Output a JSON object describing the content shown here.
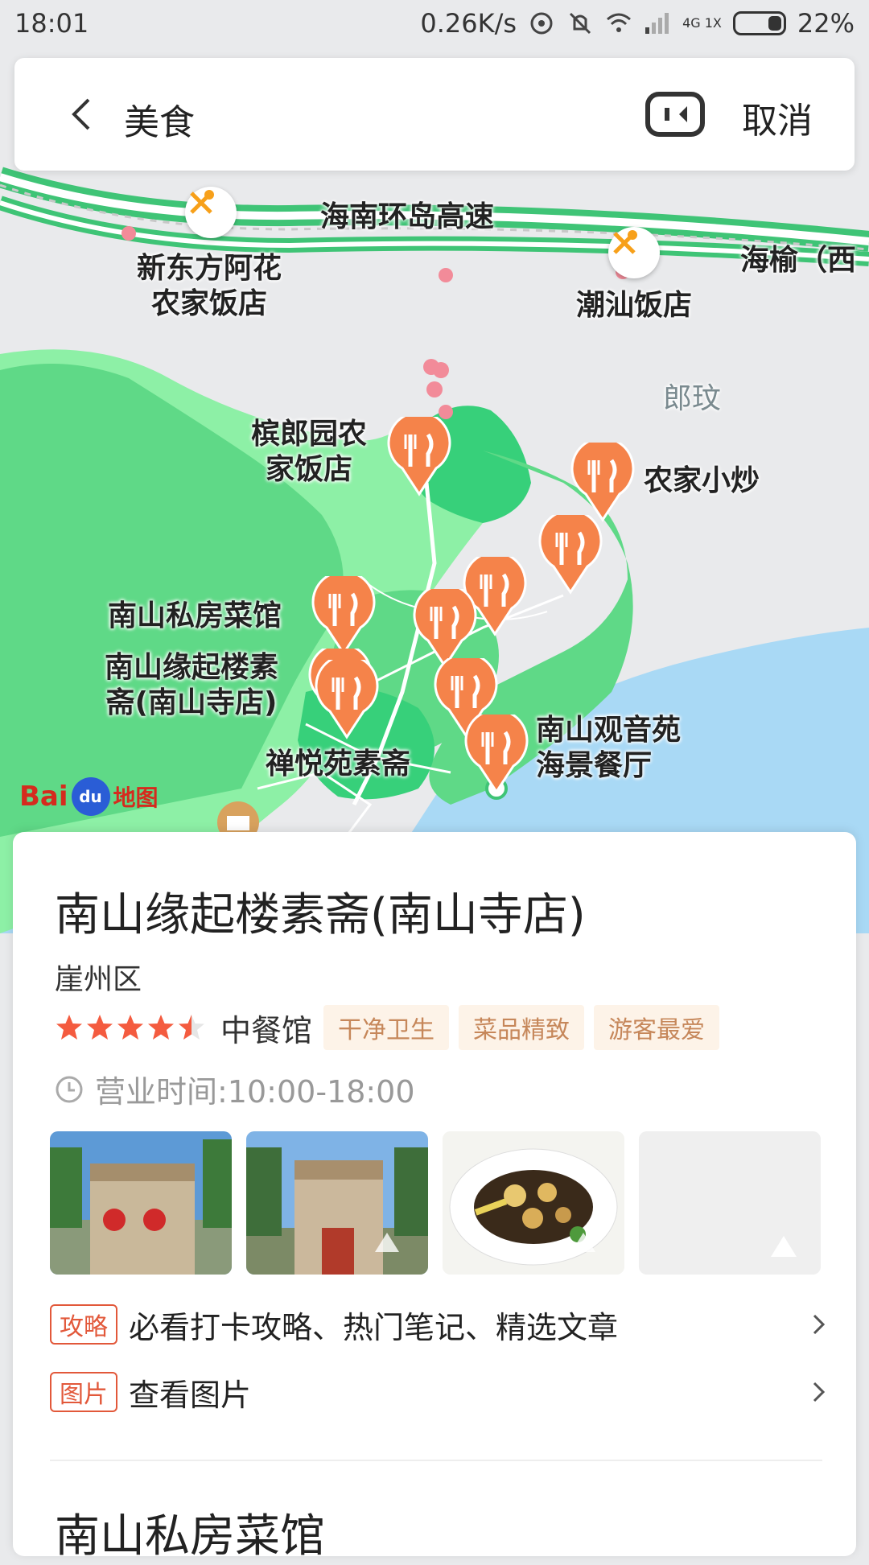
{
  "status_bar": {
    "time": "18:01",
    "speed": "0.26K/s",
    "network": "4G 1X",
    "battery": "22%"
  },
  "search": {
    "query": "美食",
    "cancel_label": "取消"
  },
  "map": {
    "road_label": "海南环岛高速",
    "road_label_2": "海榆（西",
    "area_label": "郎玟",
    "poi_labels": {
      "xindongfang": "新东方阿花\n农家饭店",
      "chaoshan": "潮汕饭店",
      "binlangyuan": "槟郎园农\n家饭店",
      "nongjia": "农家小炒",
      "sifang": "南山私房菜馆",
      "yuanqi": "南山缘起楼素\n斋(南山寺店)",
      "chanyue": "禅悦苑素斋",
      "guanyin": "南山观音苑\n海景餐厅"
    },
    "logo_text": "Bai",
    "logo_text2": "地图"
  },
  "card": {
    "name": "南山缘起楼素斋(南山寺店)",
    "district": "崖州区",
    "rating": 4.5,
    "category": "中餐馆",
    "tags": [
      "干净卫生",
      "菜品精致",
      "游客最爱"
    ],
    "hours": "营业时间:10:00-18:00",
    "links": [
      {
        "badge": "攻略",
        "text": "必看打卡攻略、热门笔记、精选文章"
      },
      {
        "badge": "图片",
        "text": "查看图片"
      }
    ],
    "next_name": "南山私房菜馆"
  },
  "colors": {
    "pin_orange": "#f5834a",
    "park_green": "#5fd987",
    "highway_green": "#3fc476",
    "sea_blue": "#a9d9f5",
    "tag_text": "#c6875a",
    "badge_red": "#e2583a"
  },
  "icons": {
    "back": "back-arrow-icon",
    "ar": "ar-camera-icon",
    "clock": "clock-icon",
    "restaurant_pin": "fork-knife-pin-icon",
    "chevron": "chevron-right-icon"
  }
}
